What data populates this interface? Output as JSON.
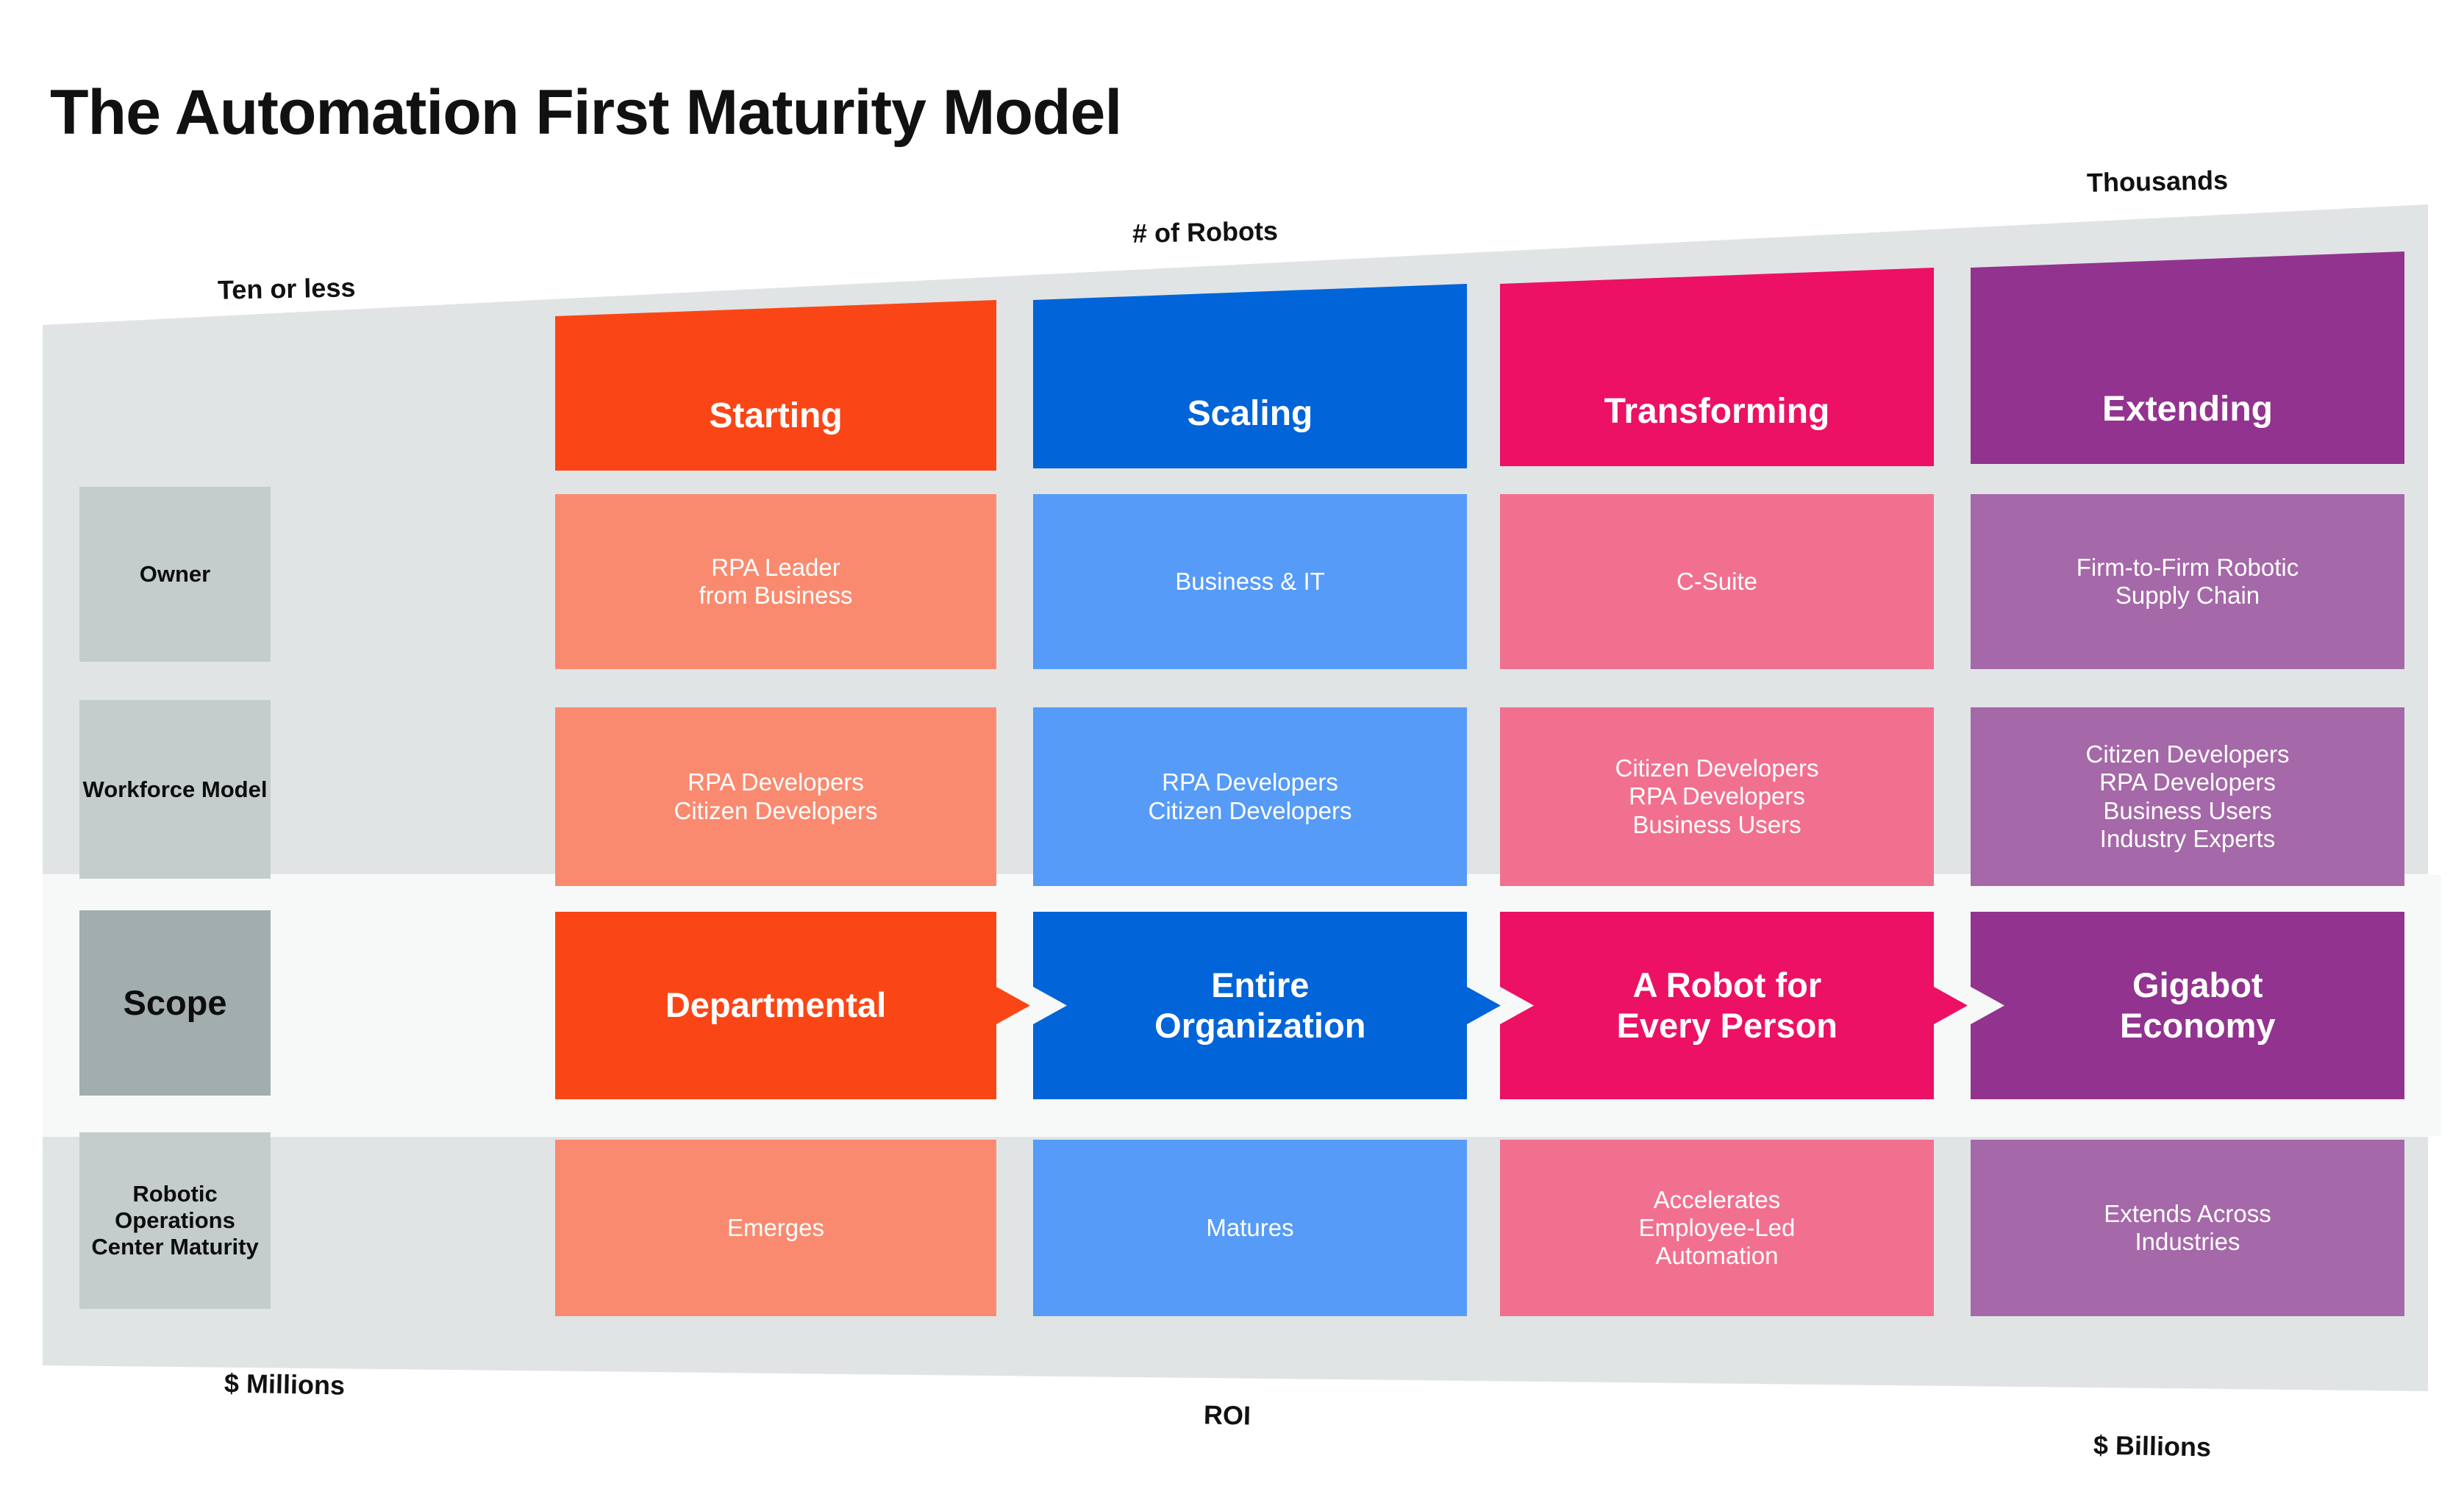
{
  "title": "The Automation First Maturity Model",
  "axis_labels": {
    "top_left": "Ten or less",
    "top_center": "# of Robots",
    "top_right": "Thousands",
    "bottom_left": "$ Millions",
    "bottom_center": "ROI",
    "bottom_right": "$ Billions"
  },
  "colors": {
    "panel_background": "#e0e4e5",
    "label_cell": "#c4cccc",
    "label_cell_scope": "#a2adad",
    "scope_band": "#f7f9f9",
    "starting_strong": "#fa4616",
    "starting_light": "#fa8a6f",
    "scaling_strong": "#0164d8",
    "scaling_light": "#569bf8",
    "transforming_strong": "#ec1164",
    "transforming_light": "#f2708f",
    "extending_strong": "#92338f",
    "extending_light": "#a568a8",
    "title_text": "#111111",
    "cell_text": "#ffffff",
    "label_text": "#0d0d0d"
  },
  "stages": [
    {
      "name": "Starting",
      "strong": "#fa4616",
      "light": "#fa8a6f"
    },
    {
      "name": "Scaling",
      "strong": "#0164d8",
      "light": "#569bf8"
    },
    {
      "name": "Transforming",
      "strong": "#ec1164",
      "light": "#f2708f"
    },
    {
      "name": "Extending",
      "strong": "#92338f",
      "light": "#a568a8"
    }
  ],
  "rows": [
    {
      "label": "Owner",
      "highlighted": false,
      "cells": [
        "RPA Leader\nfrom Business",
        "Business & IT",
        "C-Suite",
        "Firm-to-Firm Robotic\nSupply Chain"
      ]
    },
    {
      "label": "Workforce Model",
      "highlighted": false,
      "cells": [
        "RPA Developers\nCitizen Developers",
        "RPA Developers\nCitizen Developers",
        "Citizen Developers\nRPA Developers\nBusiness Users",
        "Citizen Developers\nRPA Developers\nBusiness Users\nIndustry Experts"
      ]
    },
    {
      "label": "Scope",
      "highlighted": true,
      "cells": [
        "Departmental",
        "Entire\nOrganization",
        "A Robot for\nEvery Person",
        "Gigabot\nEconomy"
      ]
    },
    {
      "label": "Robotic Operations\nCenter Maturity",
      "highlighted": false,
      "cells": [
        "Emerges",
        "Matures",
        "Accelerates\nEmployee-Led\nAutomation",
        "Extends Across\nIndustries"
      ]
    }
  ]
}
